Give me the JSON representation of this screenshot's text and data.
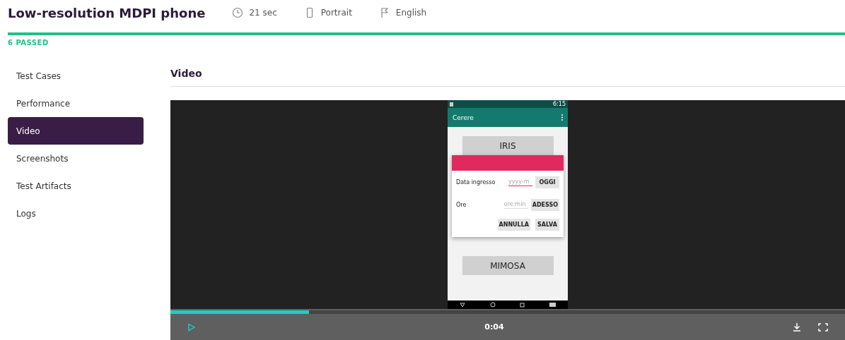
{
  "header": {
    "title": "Low-resolution MDPI phone",
    "meta": [
      {
        "kind": "clock",
        "text": "21 sec"
      },
      {
        "kind": "phone",
        "text": "Portrait"
      },
      {
        "kind": "flag",
        "text": "English"
      }
    ]
  },
  "status": {
    "label": "6 PASSED",
    "level": 1
  },
  "sidebar": {
    "items": [
      {
        "label": "Test Cases",
        "selected": false
      },
      {
        "label": "Performance",
        "selected": false
      },
      {
        "label": "Video",
        "selected": true
      },
      {
        "label": "Screenshots",
        "selected": false
      },
      {
        "label": "Test Artifacts",
        "selected": false
      },
      {
        "label": "Logs",
        "selected": false
      }
    ]
  },
  "content": {
    "heading": "Video"
  },
  "phone": {
    "clock": "6:15",
    "app_title": "Cerere",
    "top_button": "IRIS",
    "bottom_button": "MIMOSA",
    "dialog": {
      "rows": [
        {
          "label": "Data ingresso",
          "placeholder": "yyyy-m",
          "focused": true,
          "button": "OGGI"
        },
        {
          "label": "Ore",
          "placeholder": "ore:min",
          "focused": false,
          "button": "ADESSO"
        }
      ],
      "actions": [
        "ANNULLA",
        "SALVA"
      ]
    }
  },
  "player": {
    "time": "0:04",
    "level": 0.205,
    "playing": false
  }
}
